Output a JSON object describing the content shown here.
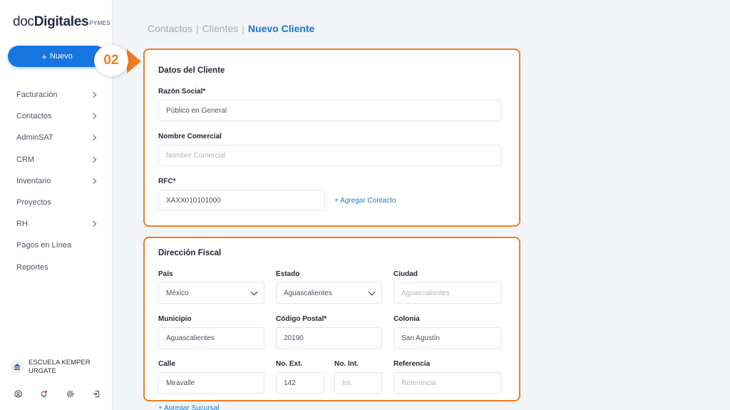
{
  "logo": {
    "part1": "doc",
    "part2": "Digitales",
    "part3": "PYMES"
  },
  "new_button": {
    "plus": "+",
    "label": "Nuevo"
  },
  "step_badge": "02",
  "nav": [
    {
      "label": "Facturación",
      "chevron": true
    },
    {
      "label": "Contactos",
      "chevron": true
    },
    {
      "label": "AdminSAT",
      "chevron": true
    },
    {
      "label": "CRM",
      "chevron": true
    },
    {
      "label": "Inventario",
      "chevron": true
    },
    {
      "label": "Proyectos",
      "chevron": false
    },
    {
      "label": "RH",
      "chevron": true
    },
    {
      "label": "Pagos en Línea",
      "chevron": false
    },
    {
      "label": "Reportes",
      "chevron": false
    }
  ],
  "user": {
    "line1": "ESCUELA KEMPER",
    "line2": "URGATE"
  },
  "breadcrumb": {
    "item1": "Contactos",
    "item2": "Clientes",
    "current": "Nuevo Cliente",
    "separator": "|"
  },
  "datos": {
    "title": "Datos del Cliente",
    "razon_label": "Razón Social*",
    "razon_value": "Público en General",
    "nombre_label": "Nombre Comercial",
    "nombre_placeholder": "Nombre Comercial",
    "rfc_label": "RFC*",
    "rfc_value": "XAXX010101000",
    "add_contact": "+ Agregar Contacto"
  },
  "direccion": {
    "title": "Dirección Fiscal",
    "pais_label": "País",
    "pais_value": "México",
    "estado_label": "Estado",
    "estado_value": "Aguascalientes",
    "ciudad_label": "Ciudad",
    "ciudad_placeholder": "Aguascalientes",
    "municipio_label": "Municipio",
    "municipio_value": "Aguascalientes",
    "cp_label": "Código Postal*",
    "cp_value": "20190",
    "colonia_label": "Colonia",
    "colonia_value": "San Agustín",
    "calle_label": "Calle",
    "calle_value": "Miravalle",
    "ext_label": "No. Ext.",
    "ext_value": "142",
    "int_label": "No. Int.",
    "int_placeholder": "Int.",
    "referencia_label": "Referencia",
    "referencia_placeholder": "Referencia"
  },
  "add_branch": "+ Agregar Sucursal",
  "colors": {
    "accent": "#1876e3",
    "highlight": "#f07d1f"
  }
}
